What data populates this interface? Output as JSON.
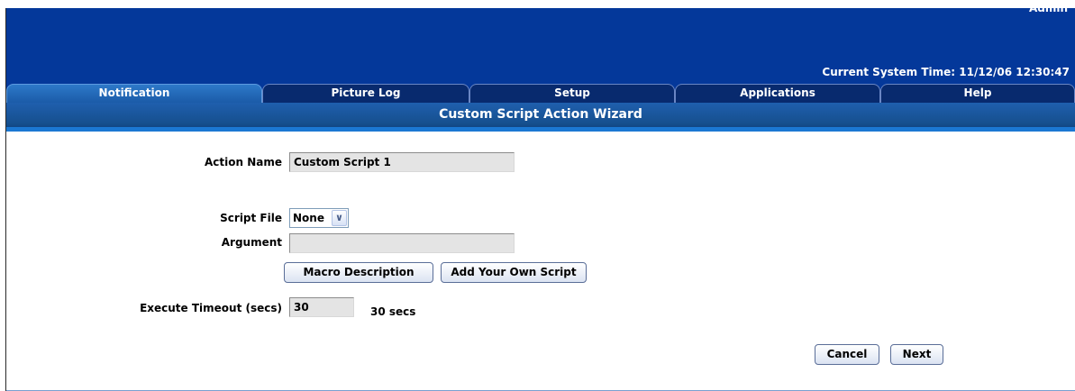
{
  "header": {
    "user": "Admin",
    "system_time": "Current System Time: 11/12/06 12:30:47"
  },
  "tabs": [
    {
      "label": "Notification",
      "active": true
    },
    {
      "label": "Picture Log",
      "active": false
    },
    {
      "label": "Setup",
      "active": false
    },
    {
      "label": "Applications",
      "active": false
    },
    {
      "label": "Help",
      "active": false
    }
  ],
  "page": {
    "title": "Custom Script Action Wizard"
  },
  "form": {
    "action_name_label": "Action Name",
    "action_name_value": "Custom Script 1",
    "script_file_label": "Script File",
    "script_file_value": "None",
    "argument_label": "Argument",
    "argument_value": "",
    "macro_button": "Macro Description",
    "add_script_button": "Add Your Own Script",
    "timeout_label": "Execute Timeout (secs)",
    "timeout_value": "30",
    "timeout_display": "30 secs"
  },
  "footer": {
    "cancel_label": "Cancel",
    "next_label": "Next"
  },
  "colors": {
    "banner": "#04389a",
    "title_bar": "#16508f",
    "active_tab": "#2d79c9",
    "inactive_tab": "#082a6e"
  }
}
